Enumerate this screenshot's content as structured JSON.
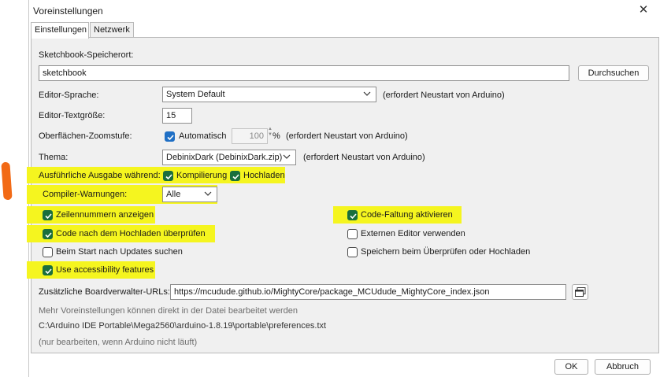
{
  "window": {
    "title": "Voreinstellungen"
  },
  "tabs": [
    {
      "label": "Einstellungen"
    },
    {
      "label": "Netzwerk"
    }
  ],
  "sketchbook": {
    "label": "Sketchbook-Speicherort:",
    "value": "sketchbook",
    "browse_label": "Durchsuchen"
  },
  "editor_language": {
    "label": "Editor-Sprache:",
    "value": "System Default",
    "note": "(erfordert Neustart von Arduino)"
  },
  "editor_font_size": {
    "label": "Editor-Textgröße:",
    "value": "15"
  },
  "zoom": {
    "label": "Oberflächen-Zoomstufe:",
    "auto_label": "Automatisch",
    "value": "100",
    "unit": "%",
    "note": "(erfordert Neustart von Arduino)"
  },
  "theme": {
    "label": "Thema:",
    "value": "DebinixDark  (DebinixDark.zip)",
    "note": "(erfordert Neustart von Arduino)"
  },
  "verbose": {
    "label": "Ausführliche Ausgabe während:",
    "compile_label": "Kompilierung",
    "upload_label": "Hochladen"
  },
  "compiler_warnings": {
    "label": "Compiler-Warnungen:",
    "value": "Alle"
  },
  "options": {
    "line_numbers": "Zeilennummern anzeigen",
    "code_folding": "Code-Faltung aktivieren",
    "verify_upload": "Code nach dem Hochladen überprüfen",
    "external_editor": "Externen Editor verwenden",
    "check_updates": "Beim Start nach Updates suchen",
    "save_on_verify": "Speichern beim Überprüfen oder Hochladen",
    "accessibility": "Use accessibility features"
  },
  "board_urls": {
    "label": "Zusätzliche Boardverwalter-URLs:",
    "value": "https://mcudude.github.io/MightyCore/package_MCUdude_MightyCore_index.json"
  },
  "footer": {
    "more_prefs": "Mehr Voreinstellungen können direkt in der Datei bearbeitet werden",
    "path": "C:\\Arduino IDE Portable\\Mega2560\\arduino-1.8.19\\portable\\preferences.txt",
    "note": "(nur bearbeiten, wenn Arduino nicht läuft)"
  },
  "buttons": {
    "ok": "OK",
    "cancel": "Abbruch"
  },
  "colors": {
    "highlight": "#f5f51f",
    "checkbox_checked": "#1a6f3d",
    "annotation_orange": "#f26a16"
  }
}
